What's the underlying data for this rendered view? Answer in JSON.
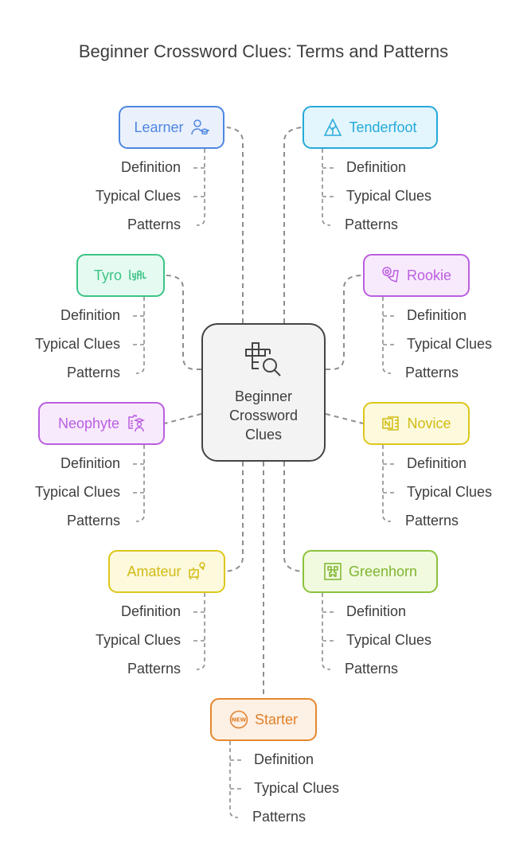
{
  "title": "Beginner Crossword Clues: Terms and Patterns",
  "center": {
    "lines": [
      "Beginner",
      "Crossword",
      "Clues"
    ],
    "icon": "crossword-search-icon"
  },
  "sub_labels": [
    "Definition",
    "Typical Clues",
    "Patterns"
  ],
  "nodes": [
    {
      "id": "learner",
      "label": "Learner",
      "icon": "student-graduate-icon",
      "border": "#4f86e0",
      "fill": "#eaf1fd",
      "text": "#4f86e0"
    },
    {
      "id": "tenderfoot",
      "label": "Tenderfoot",
      "icon": "tree-triangle-icon",
      "border": "#27a9d8",
      "fill": "#e3f6fd",
      "text": "#27a9d8"
    },
    {
      "id": "tyro",
      "label": "Tyro",
      "icon": "lyft-logo-icon",
      "border": "#3cc486",
      "fill": "#e5faf0",
      "text": "#3cc486"
    },
    {
      "id": "rookie",
      "label": "Rookie",
      "icon": "soccer-ball-cleat-icon",
      "border": "#bb5ee0",
      "fill": "#f8eafd",
      "text": "#bb5ee0"
    },
    {
      "id": "neophyte",
      "label": "Neophyte",
      "icon": "student-document-icon",
      "border": "#bb5ee0",
      "fill": "#f8eafd",
      "text": "#bb5ee0"
    },
    {
      "id": "novice",
      "label": "Novice",
      "icon": "onenote-notebook-icon",
      "border": "#dcc71c",
      "fill": "#fcf9dd",
      "text": "#d2bc12"
    },
    {
      "id": "amateur",
      "label": "Amateur",
      "icon": "easel-painting-icon",
      "border": "#dcc71c",
      "fill": "#fcf9dd",
      "text": "#d2bc12"
    },
    {
      "id": "greenhorn",
      "label": "Greenhorn",
      "icon": "creeper-face-icon",
      "border": "#8bc23c",
      "fill": "#f1fadf",
      "text": "#7fb52f"
    },
    {
      "id": "starter",
      "label": "Starter",
      "icon": "new-badge-icon",
      "border": "#e5892f",
      "fill": "#fdf0e4",
      "text": "#e0812a"
    }
  ]
}
